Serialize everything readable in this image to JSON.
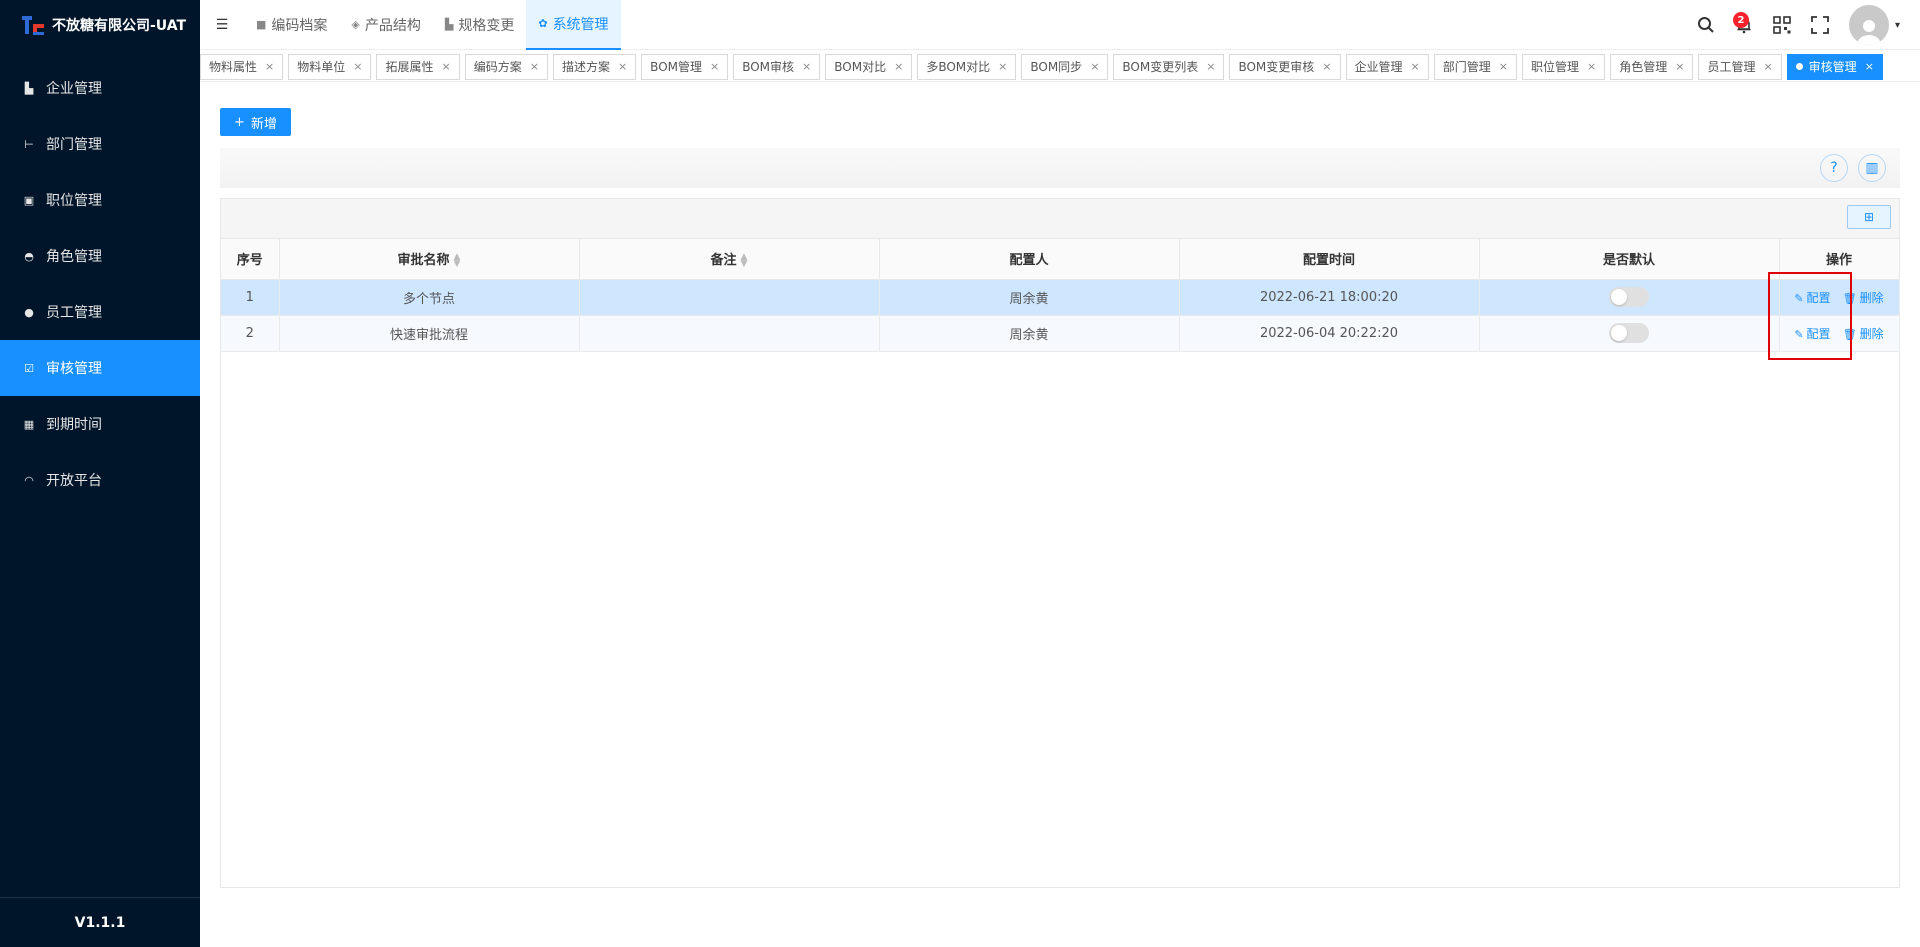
{
  "app": {
    "name": "不放糖有限公司-UAT",
    "version": "V1.1.1"
  },
  "sidebar": {
    "items": [
      {
        "label": "企业管理",
        "icon": "building-icon",
        "active": false
      },
      {
        "label": "部门管理",
        "icon": "org-tree-icon",
        "active": false
      },
      {
        "label": "职位管理",
        "icon": "id-card-icon",
        "active": false
      },
      {
        "label": "角色管理",
        "icon": "role-icon",
        "active": false
      },
      {
        "label": "员工管理",
        "icon": "users-icon",
        "active": false
      },
      {
        "label": "审核管理",
        "icon": "check-square-icon",
        "active": true
      },
      {
        "label": "到期时间",
        "icon": "calendar-icon",
        "active": false
      },
      {
        "label": "开放平台",
        "icon": "headset-icon",
        "active": false
      }
    ]
  },
  "topnav": {
    "tabs": [
      {
        "label": "编码档案",
        "icon": "folder-icon",
        "active": false
      },
      {
        "label": "产品结构",
        "icon": "layers-icon",
        "active": false
      },
      {
        "label": "规格变更",
        "icon": "spec-icon",
        "active": false
      },
      {
        "label": "系统管理",
        "icon": "gear-icon",
        "active": true
      }
    ],
    "notifications": "2"
  },
  "tags": [
    {
      "label": "物料属性",
      "active": false
    },
    {
      "label": "物料单位",
      "active": false
    },
    {
      "label": "拓展属性",
      "active": false
    },
    {
      "label": "编码方案",
      "active": false
    },
    {
      "label": "描述方案",
      "active": false
    },
    {
      "label": "BOM管理",
      "active": false
    },
    {
      "label": "BOM审核",
      "active": false
    },
    {
      "label": "BOM对比",
      "active": false
    },
    {
      "label": "多BOM对比",
      "active": false
    },
    {
      "label": "BOM同步",
      "active": false
    },
    {
      "label": "BOM变更列表",
      "active": false
    },
    {
      "label": "BOM变更审核",
      "active": false
    },
    {
      "label": "企业管理",
      "active": false
    },
    {
      "label": "部门管理",
      "active": false
    },
    {
      "label": "职位管理",
      "active": false
    },
    {
      "label": "角色管理",
      "active": false
    },
    {
      "label": "员工管理",
      "active": false
    },
    {
      "label": "审核管理",
      "active": true
    }
  ],
  "toolbar": {
    "add_label": "新增"
  },
  "table": {
    "headers": [
      "序号",
      "审批名称",
      "备注",
      "配置人",
      "配置时间",
      "是否默认",
      "操作"
    ],
    "rows": [
      {
        "no": "1",
        "name": "多个节点",
        "remark": "",
        "configurer": "周余黄",
        "time": "2022-06-21 18:00:20",
        "default": false
      },
      {
        "no": "2",
        "name": "快速审批流程",
        "remark": "",
        "configurer": "周余黄",
        "time": "2022-06-04 20:22:20",
        "default": false
      }
    ],
    "actions": {
      "config": "配置",
      "delete": "删除"
    }
  }
}
